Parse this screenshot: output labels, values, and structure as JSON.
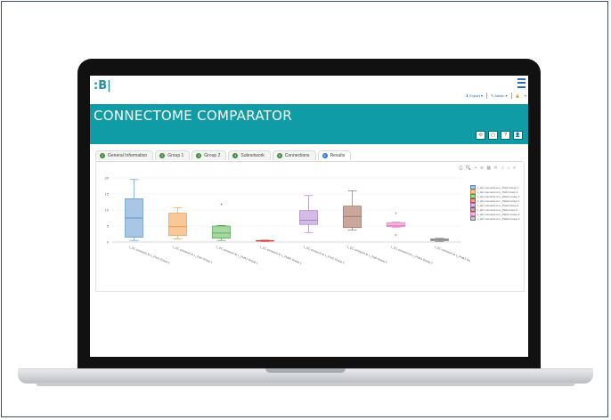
{
  "app": {
    "logo_text": ":B|",
    "title": "CONNECTOME COMPARATOR"
  },
  "toplinks": {
    "export": "⬇ Export ▾",
    "admin": "✎ Admin ▾",
    "lock": "🔒",
    "logout": "⇥"
  },
  "banner_buttons": [
    "⟲",
    "▢",
    "?",
    "👤"
  ],
  "tabs": [
    {
      "num": "1",
      "label": "General Information"
    },
    {
      "num": "2",
      "label": "Group 1"
    },
    {
      "num": "3",
      "label": "Group 2"
    },
    {
      "num": "4",
      "label": "Subnetwork"
    },
    {
      "num": "5",
      "label": "Connections"
    },
    {
      "num": "6",
      "label": "Results"
    }
  ],
  "chart_tools": "⎙ 🔍 + ⊖ ▦ ✕ ⊹ ⌂ ≡",
  "chart_data": {
    "type": "box",
    "ylim": [
      0,
      20
    ],
    "yticks": [
      0,
      5,
      10,
      15,
      20
    ],
    "categories": [
      "L_EC connects to L_PreS Group 1",
      "L_EC connects to L_PaS Group 1",
      "L_EC connects to L_PHA1 Group 1",
      "L_EC connects to L_PHA2 Group 1",
      "L_EC connects to L_PreS Group 2",
      "L_EC connects to L_PaS Group 2",
      "L_EC connects to L_PHA1 Group 2",
      "L_EC connects to L_PHA2 Group 2"
    ],
    "series": [
      {
        "name": "L_EC connects to L_PreS Group 1",
        "color": "#4a86c5",
        "fill": "#a9c6e6",
        "min": 0.5,
        "q1": 1.5,
        "median": 7.5,
        "q3": 13.5,
        "max": 19.5,
        "outliers": []
      },
      {
        "name": "L_EC connects to L_PaS Group 1",
        "color": "#f08a2a",
        "fill": "#f8c89a",
        "min": 1,
        "q1": 2,
        "median": 4.8,
        "q3": 9,
        "max": 10.7,
        "outliers": []
      },
      {
        "name": "L_EC connects to L_PHA1 Group 1",
        "color": "#3c9a3c",
        "fill": "#a7d7a0",
        "min": 0.5,
        "q1": 1.2,
        "median": 2.8,
        "q3": 5,
        "max": 5.2,
        "outliers": [
          11.8
        ]
      },
      {
        "name": "L_EC connects to L_PHA2 Group 1",
        "color": "#d23a3a",
        "fill": "#f0a0a0",
        "min": 0.2,
        "q1": 0.3,
        "median": 0.4,
        "q3": 0.5,
        "max": 0.6,
        "outliers": []
      },
      {
        "name": "L_EC connects to L_PreS Group 2",
        "color": "#9a6cc0",
        "fill": "#d3bde6",
        "min": 3,
        "q1": 5.5,
        "median": 6.8,
        "q3": 9.8,
        "max": 14.5,
        "outliers": []
      },
      {
        "name": "L_EC connects to L_PaS Group 2",
        "color": "#8b5a4a",
        "fill": "#c9a79a",
        "min": 3.8,
        "q1": 4.5,
        "median": 8,
        "q3": 11.2,
        "max": 16,
        "outliers": []
      },
      {
        "name": "L_EC connects to L_PHA1 Group 2",
        "color": "#e26ab8",
        "fill": "#f5bde0",
        "min": 4.5,
        "q1": 4.8,
        "median": 5.2,
        "q3": 6,
        "max": 6.2,
        "outliers": [
          9,
          2.2
        ]
      },
      {
        "name": "L_EC connects to L_PHA2 Group 2",
        "color": "#7a7a7a",
        "fill": "#c4c4c4",
        "min": 0.2,
        "q1": 0.4,
        "median": 0.7,
        "q3": 1,
        "max": 1.2,
        "outliers": []
      }
    ]
  }
}
